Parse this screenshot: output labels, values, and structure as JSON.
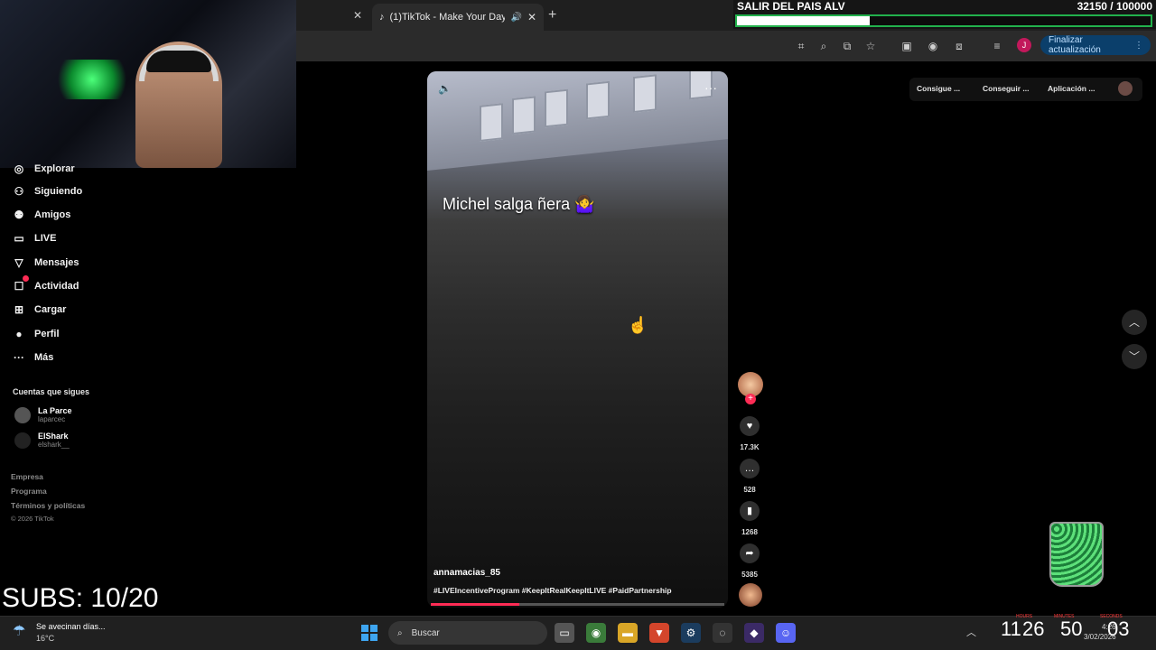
{
  "browser": {
    "tab": {
      "title": "(1)TikTok - Make Your Day"
    },
    "update_button": "Finalizar actualización",
    "profile_initial": "J"
  },
  "goal": {
    "title": "SALIR DEL PAIS ALV",
    "count": "32150 / 100000",
    "progress": 0.3215,
    "bar_color": "#22b14c"
  },
  "sidebar": {
    "items": [
      {
        "label": "Explorar",
        "icon": "compass-icon"
      },
      {
        "label": "Siguiendo",
        "icon": "person-check-icon"
      },
      {
        "label": "Amigos",
        "icon": "friends-icon"
      },
      {
        "label": "LIVE",
        "icon": "live-tv-icon"
      },
      {
        "label": "Mensajes",
        "icon": "send-icon"
      },
      {
        "label": "Actividad",
        "icon": "bell-icon"
      },
      {
        "label": "Cargar",
        "icon": "upload-plus-icon"
      },
      {
        "label": "Perfil",
        "icon": "profile-avatar"
      },
      {
        "label": "Más",
        "icon": "more-dots-icon"
      }
    ],
    "following_title": "Cuentas que sigues",
    "following": [
      {
        "name": "La Parce",
        "handle": "laparcec"
      },
      {
        "name": "ElShark",
        "handle": "elshark__"
      }
    ],
    "footer": [
      "Empresa",
      "Programa",
      "Términos y políticas"
    ],
    "copyright": "© 2026 TikTok"
  },
  "video": {
    "caption": "Michel salga ñera 🤷‍♀️",
    "username": "annamacias_85",
    "hashtags": "#LIVEIncentiveProgram #KeepItRealKeepItLIVE #PaidPartnership",
    "progress": 0.3
  },
  "actions": {
    "likes": "17.3K",
    "comments": "528",
    "saves": "1268",
    "shares": "5385"
  },
  "top_links": [
    "Consigue ...",
    "Conseguir ...",
    "Aplicación ..."
  ],
  "subs": "SUBS: 10/20",
  "taskbar": {
    "weather_title": "Se avecinan días...",
    "weather_temp": "16°C",
    "search_placeholder": "Buscar",
    "timer": {
      "hours": "11",
      "minutes": "26",
      "m2": "50",
      "seconds": "03",
      "labels": [
        "HOURS",
        "MINUTES",
        "SECONDS"
      ]
    },
    "time": "4:26",
    "date": "3/02/2026",
    "lang": "LAA"
  },
  "colors": {
    "accent": "#fe2c55",
    "update_bg": "#0b3f6b"
  }
}
